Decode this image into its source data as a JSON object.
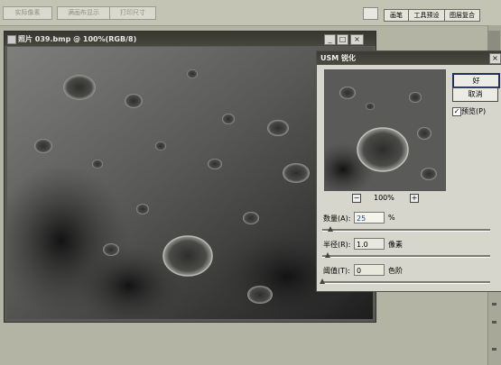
{
  "options_bar": {
    "actual_pixels": "实际像素",
    "fit_on_screen": "满画布显示",
    "print_size": "打印尺寸"
  },
  "panel_well": {
    "tabs": [
      "画笔",
      "工具预设",
      "图层复合"
    ]
  },
  "document": {
    "title": "照片 039.bmp @ 100%(RGB/8)",
    "window_buttons": [
      "_",
      "□",
      "×"
    ]
  },
  "dialog": {
    "title": "USM 锐化",
    "ok": "好",
    "cancel": "取消",
    "preview_label": "预览(P)",
    "preview_checked": true,
    "zoom_out": "−",
    "zoom_in": "+",
    "zoom": "100%",
    "amount": {
      "label": "数量(A):",
      "value": "25",
      "unit": "%",
      "level": 0.05
    },
    "radius": {
      "label": "半径(R):",
      "value": "1.0",
      "unit": "像素",
      "level": 0.03
    },
    "threshold": {
      "label": "阈值(T):",
      "value": "0",
      "unit": "色阶",
      "level": 0.0
    }
  },
  "colors": {
    "workspace": "#b4b4a4",
    "title_bar": "#3c3c34",
    "amount_text": "#1c4aa0"
  }
}
